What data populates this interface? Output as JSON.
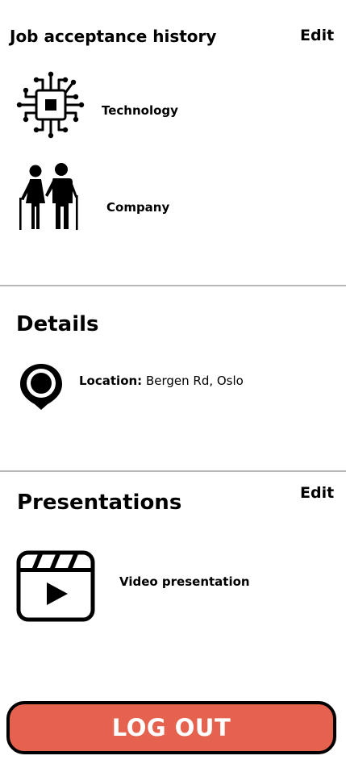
{
  "job_history": {
    "title": "Job acceptance history",
    "edit_label": "Edit",
    "items": [
      {
        "label": "Technology",
        "icon": "cpu-chip-icon"
      },
      {
        "label": "Company",
        "icon": "elderly-couple-icon"
      }
    ]
  },
  "details": {
    "title": "Details",
    "location_label": "Location:",
    "location_value": "Bergen Rd, Oslo",
    "icon": "map-pin-icon"
  },
  "presentations": {
    "title": "Presentations",
    "edit_label": "Edit",
    "items": [
      {
        "label": "Video presentation",
        "icon": "video-clapper-icon"
      }
    ]
  },
  "logout_label": "LOG OUT",
  "colors": {
    "logout_bg": "#e4624e",
    "divider": "#b8b8b8"
  }
}
